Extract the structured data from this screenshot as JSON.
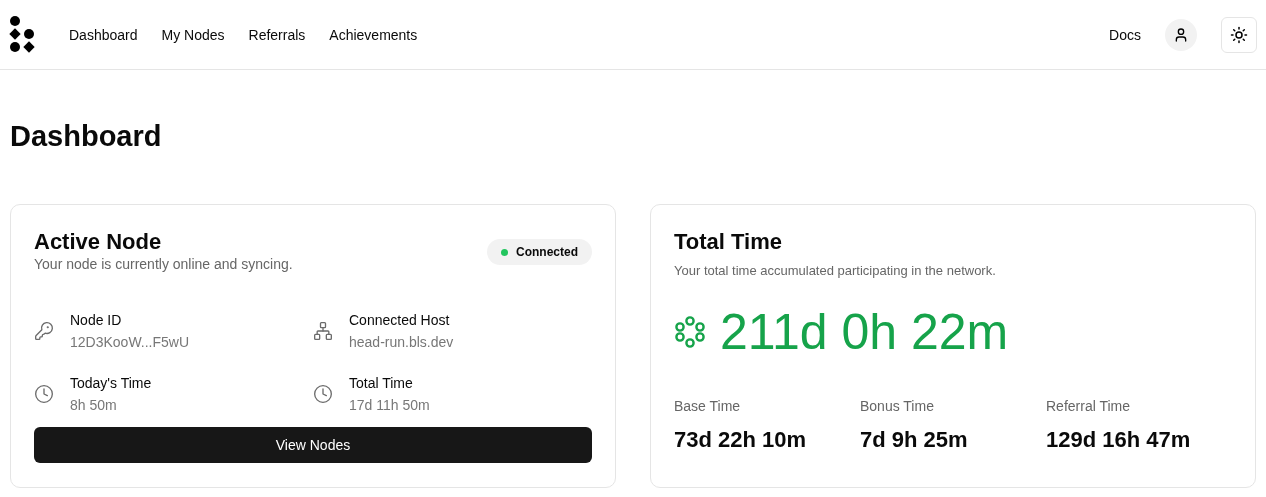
{
  "nav": {
    "links": [
      "Dashboard",
      "My Nodes",
      "Referrals",
      "Achievements"
    ],
    "docs": "Docs"
  },
  "page_title": "Dashboard",
  "active_node": {
    "title": "Active Node",
    "subtitle": "Your node is currently online and syncing.",
    "status": {
      "label": "Connected",
      "connected": true
    },
    "fields": [
      {
        "kind": "key",
        "label": "Node ID",
        "value": "12D3KooW...F5wU"
      },
      {
        "kind": "host",
        "label": "Connected Host",
        "value": "head-run.bls.dev"
      },
      {
        "kind": "clock",
        "label": "Today's Time",
        "value": "8h 50m"
      },
      {
        "kind": "clock",
        "label": "Total Time",
        "value": "17d 11h 50m"
      }
    ],
    "button": "View Nodes"
  },
  "total_time": {
    "title": "Total Time",
    "subtitle": "Your total time accumulated participating in the network.",
    "value": "211d 0h 22m",
    "breakdown": [
      {
        "label": "Base Time",
        "value": "73d 22h 10m"
      },
      {
        "label": "Bonus Time",
        "value": "7d 9h 25m"
      },
      {
        "label": "Referral Time",
        "value": "129d 16h 47m"
      }
    ]
  }
}
